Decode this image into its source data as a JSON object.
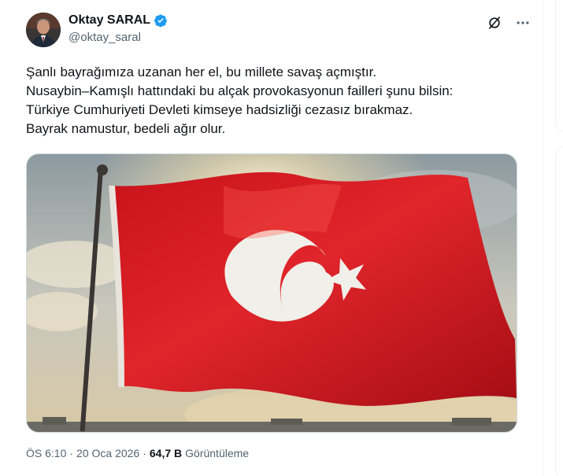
{
  "author": {
    "display_name": "Oktay SARAL",
    "handle": "@oktay_saral",
    "verified": true,
    "verified_color": "#1d9bf0"
  },
  "tweet": {
    "lines": [
      "Şanlı bayrağımıza uzanan her el, bu millete savaş açmıştır.",
      "Nusaybin–Kamışlı hattındaki bu alçak provokasyonun failleri şunu bilsin:",
      "Türkiye Cumhuriyeti Devleti kimseye hadsizliği cezasız bırakmaz.",
      "Bayrak namustur, bedeli ağır olur."
    ],
    "image": "turkish-flag-photo"
  },
  "meta": {
    "time": "ÖS 6:10",
    "separator": "·",
    "date": "20 Oca 2026",
    "views_count": "64,7 B",
    "views_label": "Görüntüleme"
  },
  "icons": {
    "grok": "grok-icon",
    "more": "more-icon"
  },
  "colors": {
    "text": "#0f1419",
    "secondary": "#536471",
    "flag_red": "#d3141c"
  }
}
